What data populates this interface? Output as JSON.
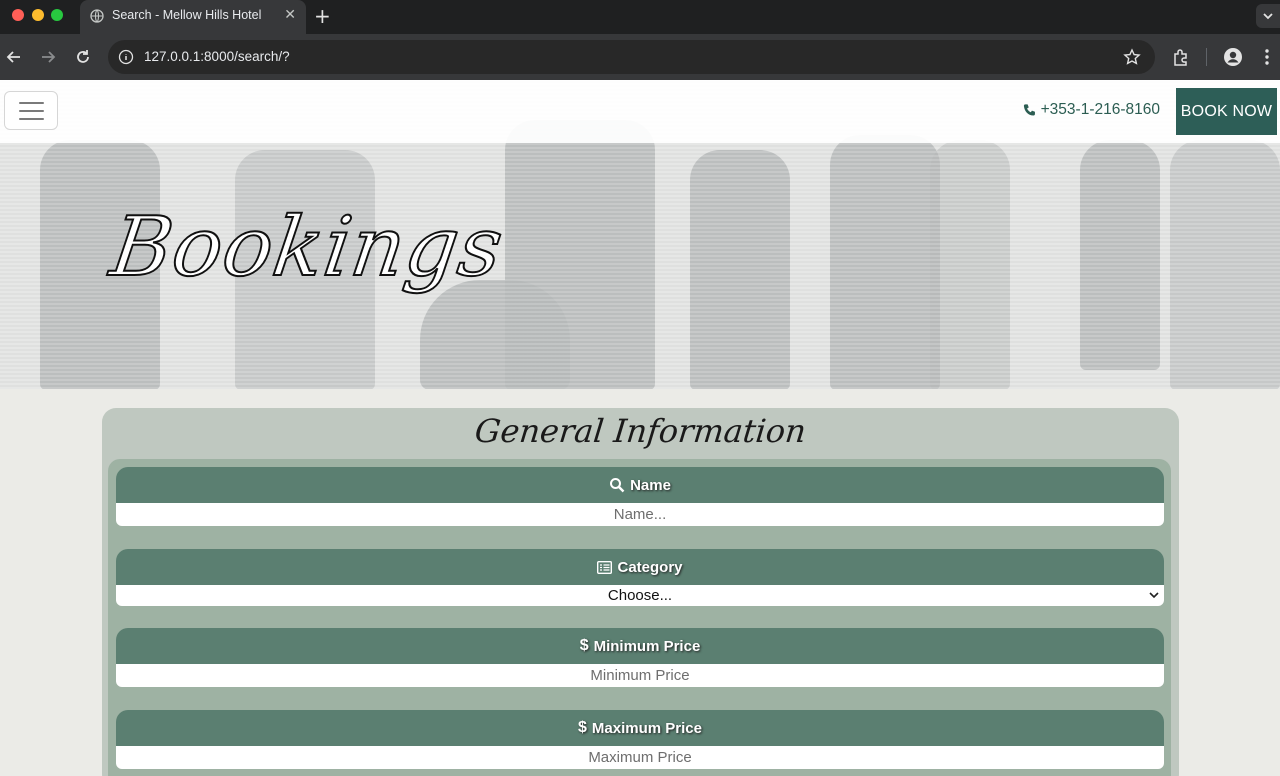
{
  "browser": {
    "tab_title": "Search - Mellow Hills Hotel",
    "tab_close": "✕",
    "new_tab": "+",
    "url": "127.0.0.1:8000/search/?"
  },
  "header": {
    "phone": "+353-1-216-8160",
    "book_label": "BOOK NOW"
  },
  "hero": {
    "title": "Bookings"
  },
  "card": {
    "title": "General Information",
    "fields": [
      {
        "icon": "search-icon",
        "label": "Name",
        "placeholder": "Name..."
      },
      {
        "icon": "list-icon",
        "label": "Category",
        "selected": "Choose..."
      },
      {
        "icon": "dollar-icon",
        "label": "Minimum Price",
        "placeholder": "Minimum Price"
      },
      {
        "icon": "dollar-icon",
        "label": "Maximum Price",
        "placeholder": "Maximum Price"
      }
    ]
  },
  "colors": {
    "accent": "#2d5e57",
    "field_header": "#5b7f71",
    "card_bg": "#bfc8c0",
    "card_inner": "#9eb2a3"
  }
}
